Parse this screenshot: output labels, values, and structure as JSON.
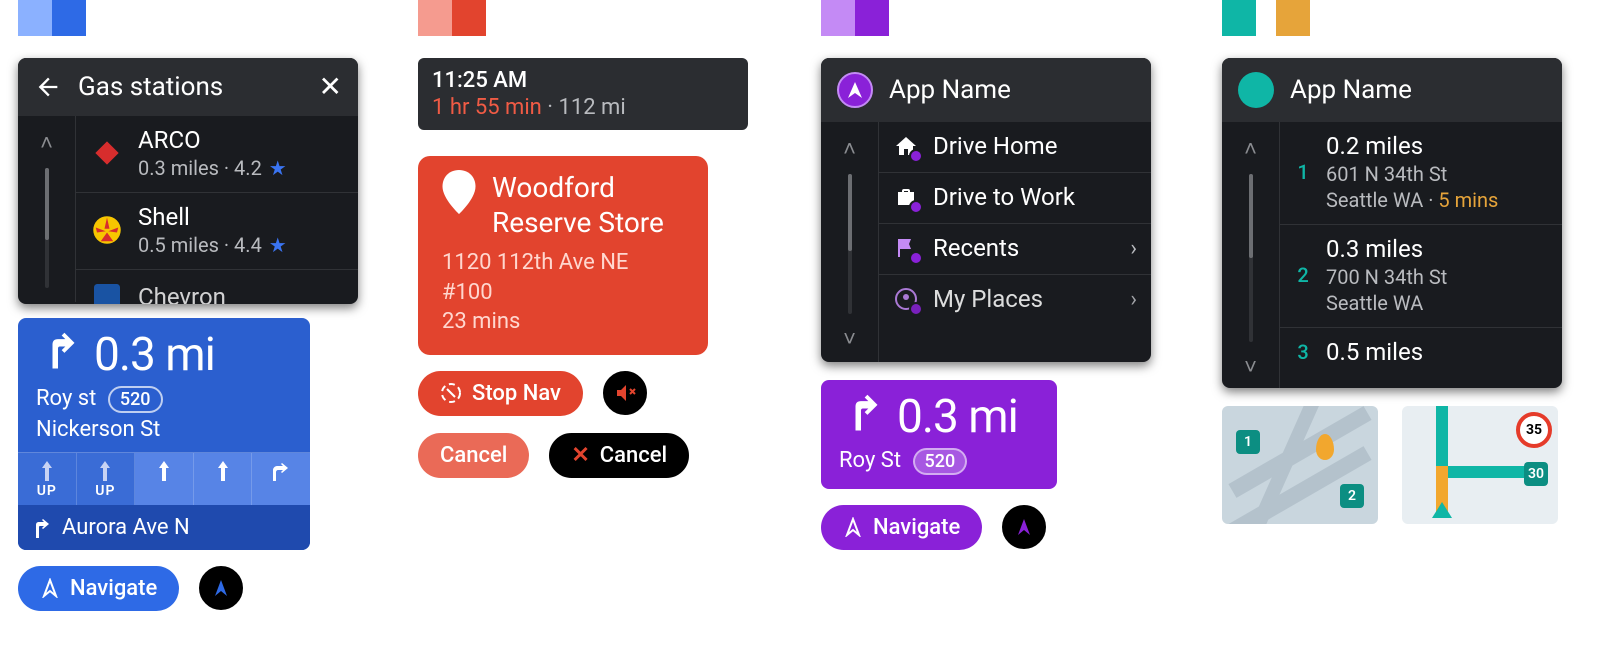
{
  "c1": {
    "search_title": "Gas stations",
    "results": [
      {
        "name": "ARCO",
        "meta": "0.3 miles · 4.2",
        "brandColor": "#d72d2d"
      },
      {
        "name": "Shell",
        "meta": "0.5 miles · 4.4",
        "brandColor": "#f7c600"
      },
      {
        "name": "Chevron",
        "meta": "",
        "brandColor": "#1a62c5"
      }
    ],
    "nav": {
      "distance": "0.3 mi",
      "street1": "Roy st",
      "route_badge": "520",
      "street2": "Nickerson St",
      "lane_pair_label": "UP",
      "next_step": "Aurora Ave N"
    },
    "navigate_label": "Navigate"
  },
  "c2": {
    "trip": {
      "time": "11:25 AM",
      "duration": "1 hr 55 min",
      "dist": "112 mi"
    },
    "dest": {
      "name_l1": "Woodford",
      "name_l2": "Reserve Store",
      "addr": "1120 112th Ave NE #100",
      "eta": "23 mins"
    },
    "stopnav_label": "Stop Nav",
    "cancel_label": "Cancel"
  },
  "c3": {
    "app_name": "App Name",
    "items": [
      {
        "label": "Drive Home",
        "icon": "home"
      },
      {
        "label": "Drive to Work",
        "icon": "work"
      },
      {
        "label": "Recents",
        "icon": "recents",
        "chevron": true
      },
      {
        "label": "My Places",
        "icon": "places",
        "chevron": true
      }
    ],
    "nav": {
      "distance": "0.3 mi",
      "street": "Roy St",
      "route_badge": "520"
    },
    "navigate_label": "Navigate"
  },
  "c4": {
    "app_name": "App Name",
    "items": [
      {
        "n": "1",
        "primary": "0.2 miles",
        "l2": "601 N 34th St",
        "l3a": "Seattle WA · ",
        "l3b": "5 mins"
      },
      {
        "n": "2",
        "primary": "0.3 miles",
        "l2": "700 N 34th St",
        "l3a": "Seattle WA",
        "l3b": ""
      },
      {
        "n": "3",
        "primary": "0.5 miles",
        "l2": "",
        "l3a": "",
        "l3b": ""
      }
    ],
    "map2": {
      "speed": "35",
      "pin": "30"
    },
    "map1": {
      "pin_a": "1",
      "pin_b": "2"
    }
  },
  "colors": {
    "c1a": "#8bb1ff",
    "c1b": "#2e6ae6",
    "c2a": "#f59b8f",
    "c2b": "#e2442e",
    "c3a": "#c48af5",
    "c3b": "#8a21d8",
    "c4a": "#0fb6a6",
    "c4b": "#e6a43a"
  }
}
